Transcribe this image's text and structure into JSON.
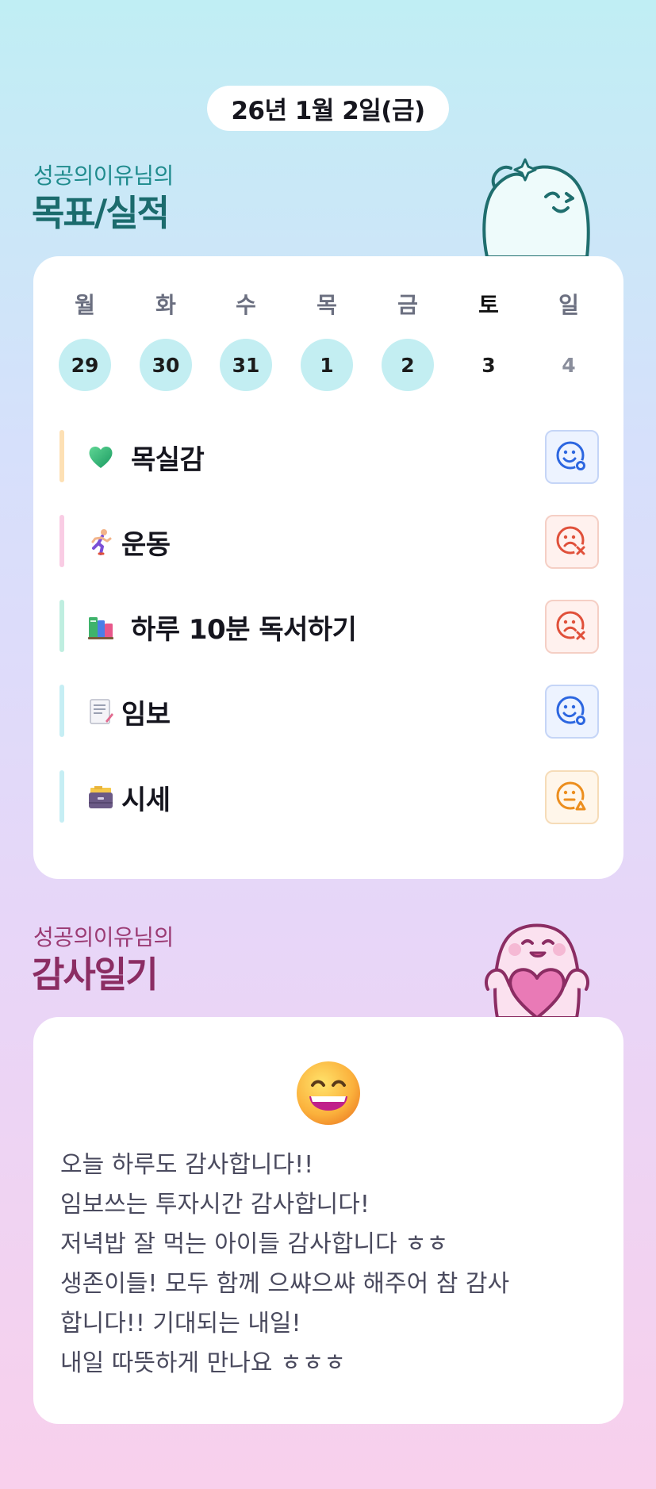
{
  "header": {
    "date": "26년 1월 2일(금)"
  },
  "goals_section": {
    "subtitle": "성공의이유님의",
    "title": "목표/실적"
  },
  "week": {
    "days": [
      {
        "name": "월",
        "num": "29",
        "filled": true
      },
      {
        "name": "화",
        "num": "30",
        "filled": true
      },
      {
        "name": "수",
        "num": "31",
        "filled": true
      },
      {
        "name": "목",
        "num": "1",
        "filled": true
      },
      {
        "name": "금",
        "num": "2",
        "filled": true
      },
      {
        "name": "토",
        "num": "3",
        "filled": false
      },
      {
        "name": "일",
        "num": "4",
        "filled": false
      }
    ]
  },
  "goals": [
    {
      "icon": "green-heart-icon",
      "label": "목실감",
      "bar_color": "#fde0b4",
      "status": "done",
      "status_icon": "smile-circle-icon"
    },
    {
      "icon": "runner-icon",
      "label": "운동",
      "bar_color": "#f9cce4",
      "status": "failed",
      "status_icon": "sad-x-icon"
    },
    {
      "icon": "books-icon",
      "label": "하루 10분 독서하기",
      "bar_color": "#bfeee0",
      "status": "failed",
      "status_icon": "sad-x-icon"
    },
    {
      "icon": "memo-icon",
      "label": "임보",
      "bar_color": "#c6eef4",
      "status": "done",
      "status_icon": "smile-circle-icon"
    },
    {
      "icon": "file-cabinet-icon",
      "label": "시세",
      "bar_color": "#c6eef4",
      "status": "partial",
      "status_icon": "meh-triangle-icon"
    }
  ],
  "gratitude_section": {
    "subtitle": "성공의이유님의",
    "title": "감사일기",
    "mood_icon": "grinning-face-icon",
    "lines": [
      "오늘 하루도 감사합니다!!",
      "임보쓰는 투자시간 감사합니다!",
      "저녁밥 잘 먹는 아이들 감사합니다 ㅎㅎ",
      "생존이들! 모두 함께 으쌰으쌰 해주어 참 감사",
      "합니다!! 기대되는 내일!",
      "내일 따뜻하게 만나요 ㅎㅎㅎ"
    ]
  },
  "colors": {
    "teal_title": "#1b6b6d",
    "pink_title": "#8b2d63",
    "day_fill": "#c3eef2",
    "good_blue": "#2c66e0",
    "bad_red": "#e0503a",
    "mid_orange": "#ec8e1e"
  }
}
